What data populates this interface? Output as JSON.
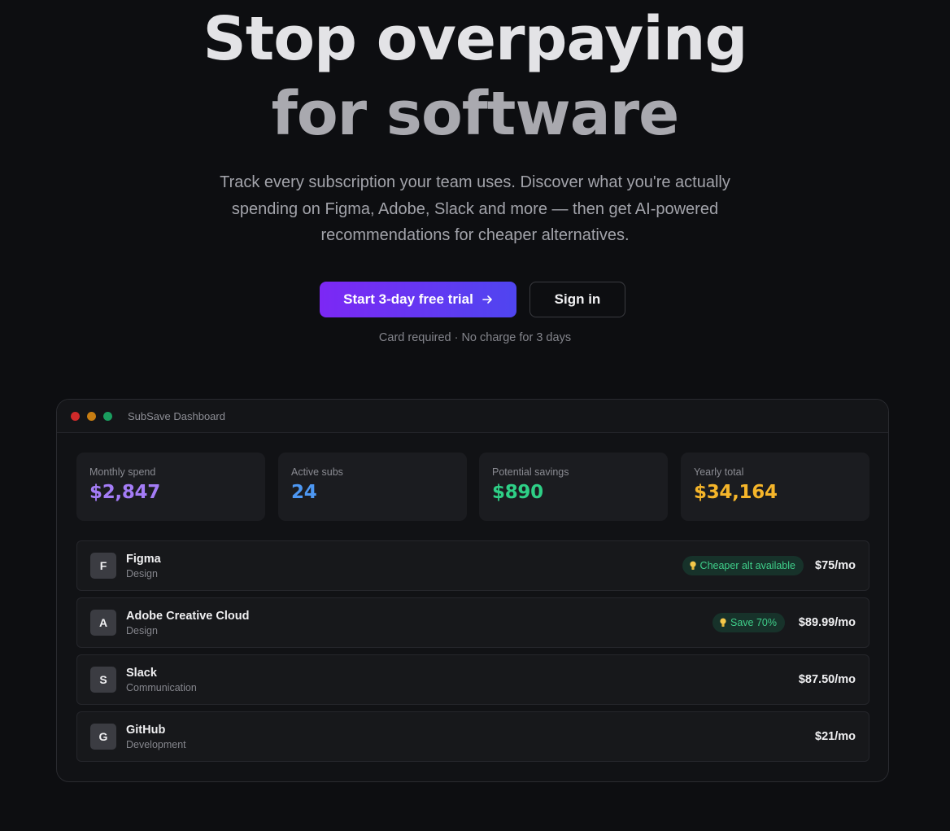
{
  "hero": {
    "title_line1": "Stop overpaying",
    "title_line2": "for software",
    "subtitle": "Track every subscription your team uses. Discover what you're actually spending on Figma, Adobe, Slack and more — then get AI-powered recommendations for cheaper alternatives.",
    "primary_cta": "Start 3-day free trial",
    "primary_cta_icon": "arrow-right-icon",
    "secondary_cta": "Sign in",
    "fine_print": "Card required · No charge for 3 days"
  },
  "dashboard": {
    "window_title": "SubSave Dashboard",
    "stats": [
      {
        "label": "Monthly spend",
        "value": "$2,847",
        "color": "#a47cf6"
      },
      {
        "label": "Active subs",
        "value": "24",
        "color": "#4d97f2"
      },
      {
        "label": "Potential savings",
        "value": "$890",
        "color": "#2ecf86"
      },
      {
        "label": "Yearly total",
        "value": "$34,164",
        "color": "#f5b52a"
      }
    ],
    "subscriptions": [
      {
        "initial": "F",
        "name": "Figma",
        "category": "Design",
        "badge": "Cheaper alt available",
        "badge_icon": "lightbulb-icon",
        "price": "$75/mo"
      },
      {
        "initial": "A",
        "name": "Adobe Creative Cloud",
        "category": "Design",
        "badge": "Save 70%",
        "badge_icon": "lightbulb-icon",
        "price": "$89.99/mo"
      },
      {
        "initial": "S",
        "name": "Slack",
        "category": "Communication",
        "price": "$87.50/mo"
      },
      {
        "initial": "G",
        "name": "GitHub",
        "category": "Development",
        "price": "$21/mo"
      }
    ]
  },
  "colors": {
    "background": "#0d0e11",
    "accent_gradient_start": "#7c28f4",
    "accent_gradient_end": "#4f45f0",
    "badge_text": "#3fcf8a"
  }
}
